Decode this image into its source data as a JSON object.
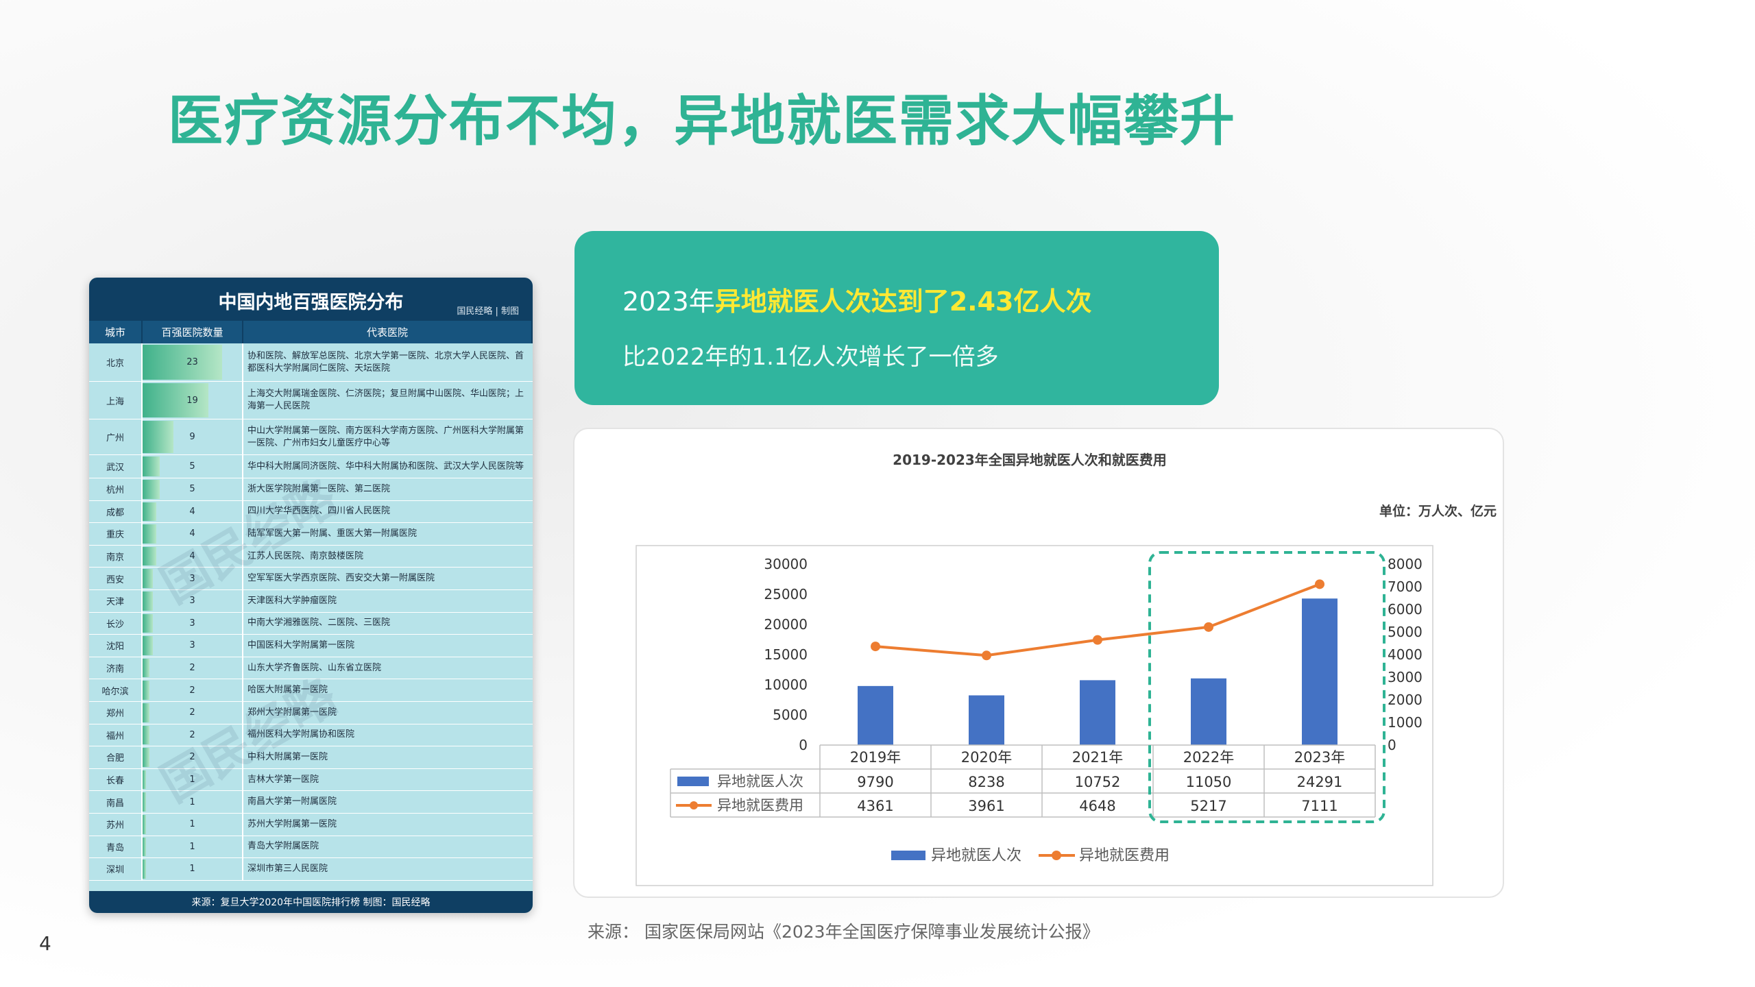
{
  "title": "医疗资源分布不均，异地就医需求大幅攀升",
  "page_number": "4",
  "table": {
    "title": "中国内地百强医院分布",
    "brand": "国民经略 | 制图",
    "columns": [
      "城市",
      "百强医院数量",
      "代表医院"
    ],
    "max_value": 23,
    "rows": [
      {
        "city": "北京",
        "count": 23,
        "hospitals": "协和医院、解放军总医院、北京大学第一医院、北京大学人民医院、首都医科大学附属同仁医院、天坛医院"
      },
      {
        "city": "上海",
        "count": 19,
        "hospitals": "上海交大附属瑞金医院、仁济医院；复旦附属中山医院、华山医院；上海第一人民医院"
      },
      {
        "city": "广州",
        "count": 9,
        "hospitals": "中山大学附属第一医院、南方医科大学南方医院、广州医科大学附属第一医院、广州市妇女儿童医疗中心等"
      },
      {
        "city": "武汉",
        "count": 5,
        "hospitals": "华中科大附属同济医院、华中科大附属协和医院、武汉大学人民医院等"
      },
      {
        "city": "杭州",
        "count": 5,
        "hospitals": "浙大医学院附属第一医院、第二医院"
      },
      {
        "city": "成都",
        "count": 4,
        "hospitals": "四川大学华西医院、四川省人民医院"
      },
      {
        "city": "重庆",
        "count": 4,
        "hospitals": "陆军军医大第一附属、重医大第一附属医院"
      },
      {
        "city": "南京",
        "count": 4,
        "hospitals": "江苏人民医院、南京鼓楼医院"
      },
      {
        "city": "西安",
        "count": 3,
        "hospitals": "空军军医大学西京医院、西安交大第一附属医院"
      },
      {
        "city": "天津",
        "count": 3,
        "hospitals": "天津医科大学肿瘤医院"
      },
      {
        "city": "长沙",
        "count": 3,
        "hospitals": "中南大学湘雅医院、二医院、三医院"
      },
      {
        "city": "沈阳",
        "count": 3,
        "hospitals": "中国医科大学附属第一医院"
      },
      {
        "city": "济南",
        "count": 2,
        "hospitals": "山东大学齐鲁医院、山东省立医院"
      },
      {
        "city": "哈尔滨",
        "count": 2,
        "hospitals": "哈医大附属第一医院"
      },
      {
        "city": "郑州",
        "count": 2,
        "hospitals": "郑州大学附属第一医院"
      },
      {
        "city": "福州",
        "count": 2,
        "hospitals": "福州医科大学附属协和医院"
      },
      {
        "city": "合肥",
        "count": 2,
        "hospitals": "中科大附属第一医院"
      },
      {
        "city": "长春",
        "count": 1,
        "hospitals": "吉林大学第一医院"
      },
      {
        "city": "南昌",
        "count": 1,
        "hospitals": "南昌大学第一附属医院"
      },
      {
        "city": "苏州",
        "count": 1,
        "hospitals": "苏州大学附属第一医院"
      },
      {
        "city": "青岛",
        "count": 1,
        "hospitals": "青岛大学附属医院"
      },
      {
        "city": "深圳",
        "count": 1,
        "hospitals": "深圳市第三人民医院"
      }
    ],
    "footer": "来源：复旦大学2020年中国医院排行榜  制图：国民经略",
    "watermark": "国民经略"
  },
  "callout": {
    "line1_pre": "2023年",
    "line1_highlight": "异地就医人次达到了2.43亿人次",
    "line2": "比2022年的1.1亿人次增长了一倍多"
  },
  "chart_data": {
    "type": "bar",
    "title": "2019-2023年全国异地就医人次和就医费用",
    "unit": "单位：万人次、亿元",
    "categories": [
      "2019年",
      "2020年",
      "2021年",
      "2022年",
      "2023年"
    ],
    "series": [
      {
        "name": "异地就医人次",
        "type": "bar",
        "axis": "left",
        "color": "#4472c4",
        "values": [
          9790,
          8238,
          10752,
          11050,
          24291
        ]
      },
      {
        "name": "异地就医费用",
        "type": "line",
        "axis": "right",
        "color": "#ed7d31",
        "values": [
          4361,
          3961,
          4648,
          5217,
          7111
        ]
      }
    ],
    "y_left": {
      "min": 0,
      "max": 30000,
      "ticks": [
        0,
        5000,
        10000,
        15000,
        20000,
        25000,
        30000
      ]
    },
    "y_right": {
      "min": 0,
      "max": 8000,
      "ticks": [
        0,
        1000,
        2000,
        3000,
        4000,
        5000,
        6000,
        7000,
        8000
      ]
    },
    "highlight_categories": [
      "2022年",
      "2023年"
    ],
    "highlight_color": "#2fb394",
    "legend_position": "bottom",
    "data_table": true
  },
  "footnote": "来源：  国家医保局网站《2023年全国医疗保障事业发展统计公报》",
  "colors": {
    "title": "#2fb394",
    "callout_bg": "#30b59e",
    "callout_highlight": "#ffe933",
    "table_header": "#0f3f63"
  }
}
